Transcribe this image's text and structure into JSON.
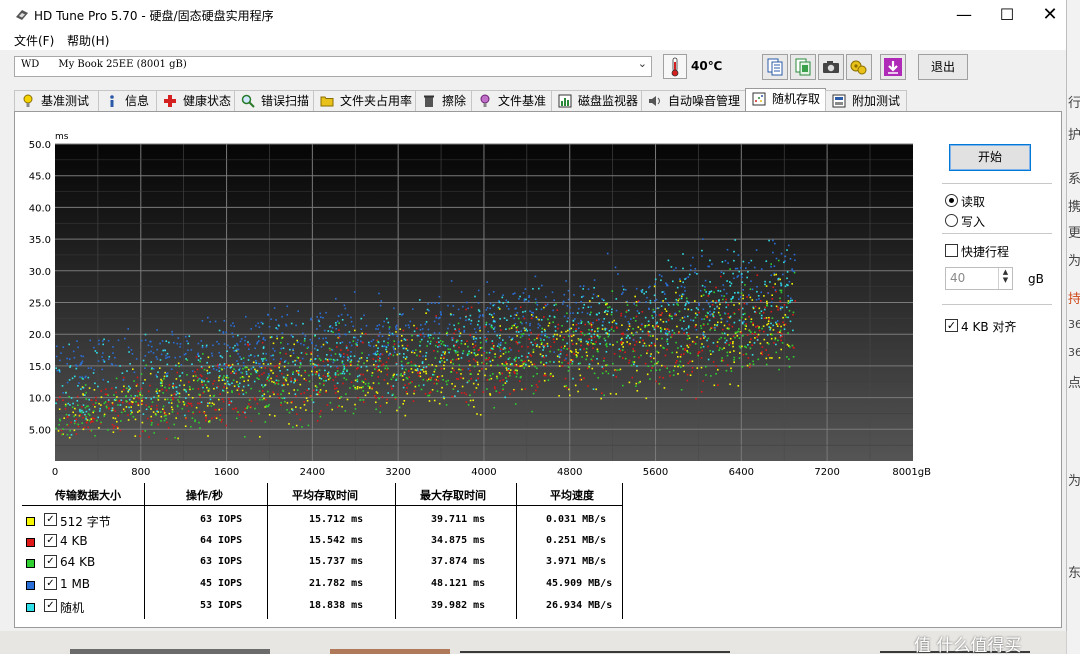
{
  "window": {
    "title": "HD Tune Pro 5.70 - 硬盘/固态硬盘实用程序",
    "controls": [
      "minimize-icon",
      "maximize-icon",
      "close-icon"
    ]
  },
  "menu": [
    {
      "label": "文件(F)"
    },
    {
      "label": "帮助(H)"
    }
  ],
  "toolbar": {
    "drive": "WD      My Book 25EE (8001 gB)",
    "temperature": "40℃",
    "icons": [
      "copy-text-icon",
      "copy-image-icon",
      "camera-icon",
      "options-icon",
      "save-icon"
    ],
    "exit_label": "退出"
  },
  "tabs": [
    {
      "label": "基准测试",
      "icon": "benchmark-icon"
    },
    {
      "label": "信息",
      "icon": "info-icon"
    },
    {
      "label": "健康状态",
      "icon": "health-icon"
    },
    {
      "label": "错误扫描",
      "icon": "magnifier-icon"
    },
    {
      "label": "文件夹占用率",
      "icon": "folder-icon"
    },
    {
      "label": "擦除",
      "icon": "trash-icon"
    },
    {
      "label": "文件基准",
      "icon": "file-benchmark-icon"
    },
    {
      "label": "磁盘监视器",
      "icon": "monitor-icon"
    },
    {
      "label": "自动噪音管理",
      "icon": "speaker-icon"
    },
    {
      "label": "随机存取",
      "icon": "random-access-icon",
      "active": true
    },
    {
      "label": "附加测试",
      "icon": "extra-tests-icon"
    }
  ],
  "controls": {
    "start_label": "开始",
    "read_label": "读取",
    "write_label": "写入",
    "mode": "read",
    "short_stroke_label": "快捷行程",
    "short_stroke_checked": false,
    "short_stroke_value": "40",
    "short_stroke_unit": "gB",
    "align_label": "4 KB 对齐",
    "align_checked": true
  },
  "results": {
    "headers": [
      "传输数据大小",
      "操作/秒",
      "平均存取时间",
      "最大存取时间",
      "平均速度"
    ],
    "rows": [
      {
        "name": "512 字节",
        "color": "#f7f700",
        "checked": true,
        "ops": "63 IOPS",
        "avg": "15.712 ms",
        "max": "39.711 ms",
        "speed": "0.031 MB/s"
      },
      {
        "name": "4 KB",
        "color": "#e01818",
        "checked": true,
        "ops": "64 IOPS",
        "avg": "15.542 ms",
        "max": "34.875 ms",
        "speed": "0.251 MB/s"
      },
      {
        "name": "64 KB",
        "color": "#2fd02f",
        "checked": true,
        "ops": "63 IOPS",
        "avg": "15.737 ms",
        "max": "37.874 ms",
        "speed": "3.971 MB/s"
      },
      {
        "name": "1 MB",
        "color": "#2a6fd8",
        "checked": true,
        "ops": "45 IOPS",
        "avg": "21.782 ms",
        "max": "48.121 ms",
        "speed": "45.909 MB/s"
      },
      {
        "name": "随机",
        "color": "#30e0e8",
        "checked": true,
        "ops": "53 IOPS",
        "avg": "18.838 ms",
        "max": "39.982 ms",
        "speed": "26.934 MB/s"
      }
    ]
  },
  "chart_data": {
    "type": "scatter",
    "ylabel": "ms",
    "xlim": [
      0,
      8001
    ],
    "ylim": [
      0,
      50
    ],
    "y_ticks": [
      "5.00",
      "10.0",
      "15.0",
      "20.0",
      "25.0",
      "30.0",
      "35.0",
      "40.0",
      "45.0",
      "50.0"
    ],
    "x_ticks": [
      "0",
      "800",
      "1600",
      "2400",
      "3200",
      "4000",
      "4800",
      "5600",
      "6400",
      "7200",
      "8001gB"
    ],
    "grid": true,
    "series": [
      {
        "color": "#f7f700",
        "x": [
          0,
          2000,
          4000,
          6000,
          8001
        ],
        "y": [
          7,
          12,
          16,
          20,
          25
        ],
        "spread": [
          4,
          6,
          6,
          7,
          8
        ]
      },
      {
        "color": "#e01818",
        "x": [
          0,
          2000,
          4000,
          6000,
          8001
        ],
        "y": [
          7,
          12,
          16,
          20,
          25
        ],
        "spread": [
          4,
          6,
          6,
          7,
          8
        ]
      },
      {
        "color": "#2fd02f",
        "x": [
          0,
          2000,
          4000,
          6000,
          8001
        ],
        "y": [
          7,
          12,
          16,
          20,
          25
        ],
        "spread": [
          4,
          6,
          6,
          7,
          8
        ]
      },
      {
        "color": "#2a6fd8",
        "x": [
          0,
          2000,
          4000,
          6000,
          8001
        ],
        "y": [
          15,
          19,
          22,
          27,
          33
        ],
        "spread": [
          4,
          5,
          5,
          6,
          6
        ]
      },
      {
        "color": "#30e0e8",
        "x": [
          0,
          2000,
          4000,
          6000,
          8001
        ],
        "y": [
          11,
          15,
          19,
          24,
          29
        ],
        "spread": [
          5,
          6,
          6,
          7,
          7
        ]
      }
    ]
  },
  "background_fragments": {
    "right_edge": [
      "行",
      "护",
      "系",
      "携",
      "更",
      "为",
      "持",
      "36",
      "36",
      "点",
      "为",
      "东"
    ],
    "bottom_watermark": "值 什么值得买"
  }
}
